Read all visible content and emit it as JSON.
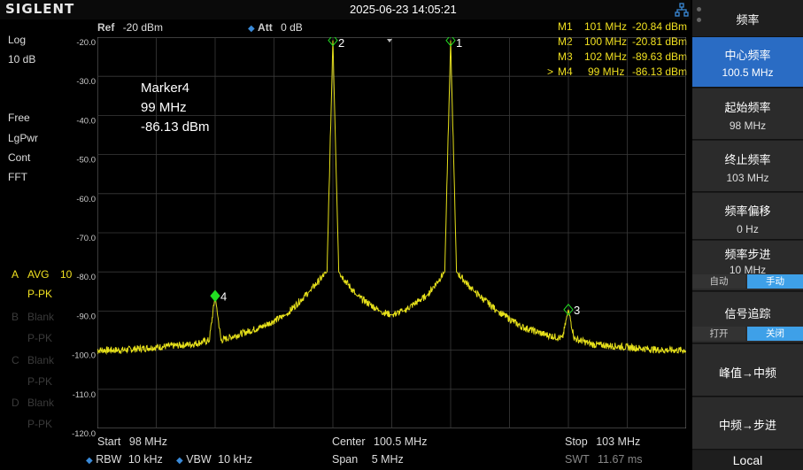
{
  "header": {
    "brand": "SIGLENT",
    "datetime": "2025-06-23 14:05:21"
  },
  "trace_settings": {
    "scale_type": "Log",
    "scale_div": "10 dB",
    "sweep_mode": "Free",
    "detector_type": "LgPwr",
    "cont": "Cont",
    "mode": "FFT"
  },
  "traces": [
    {
      "id": "A",
      "mode": "AVG",
      "count": "10",
      "detector": "P-PK",
      "active": true
    },
    {
      "id": "B",
      "mode": "Blank",
      "detector": "P-PK",
      "active": false
    },
    {
      "id": "C",
      "mode": "Blank",
      "detector": "P-PK",
      "active": false
    },
    {
      "id": "D",
      "mode": "Blank",
      "detector": "P-PK",
      "active": false
    }
  ],
  "top_info": {
    "ref_label": "Ref",
    "ref_value": "-20 dBm",
    "att_label": "Att",
    "att_value": "0 dB"
  },
  "markers": [
    {
      "name": "M1",
      "freq": "101 MHz",
      "level": "-20.84 dBm",
      "selected": false
    },
    {
      "name": "M2",
      "freq": "100 MHz",
      "level": "-20.81 dBm",
      "selected": false
    },
    {
      "name": "M3",
      "freq": "102 MHz",
      "level": "-89.63 dBm",
      "selected": false
    },
    {
      "name": "M4",
      "freq": "99 MHz",
      "level": "-86.13 dBm",
      "selected": true
    }
  ],
  "marker_select_glyph": ">",
  "marker_readout": {
    "name": "Marker4",
    "freq": "99 MHz",
    "level": "-86.13 dBm"
  },
  "chart_data": {
    "type": "line",
    "y_ticks": [
      "-20.0",
      "-30.0",
      "-40.0",
      "-50.0",
      "-60.0",
      "-70.0",
      "-80.0",
      "-90.0",
      "-100.0",
      "-110.0",
      "-120.0"
    ],
    "xlim": [
      98,
      103
    ],
    "ylim": [
      -120,
      -20
    ],
    "grid": true,
    "series": [
      {
        "x": [
          98.0,
          98.2,
          98.4,
          98.6,
          98.8,
          98.95,
          99.0,
          99.05,
          99.2,
          99.4,
          99.6,
          99.8,
          99.95,
          100.0,
          100.05,
          100.2,
          100.4,
          100.5,
          100.6,
          100.8,
          100.95,
          101.0,
          101.05,
          101.2,
          101.4,
          101.6,
          101.8,
          101.95,
          102.0,
          102.05,
          102.2,
          102.4,
          102.6,
          102.8,
          103.0
        ],
        "y": [
          -100.0,
          -100.0,
          -99.5,
          -99.0,
          -98.5,
          -97.5,
          -86.13,
          -97.5,
          -96.0,
          -94.0,
          -91.0,
          -85.0,
          -80.0,
          -20.81,
          -80.0,
          -86.0,
          -90.0,
          -91.0,
          -90.0,
          -86.0,
          -80.0,
          -20.84,
          -80.0,
          -85.0,
          -90.0,
          -94.0,
          -96.0,
          -97.0,
          -89.63,
          -97.0,
          -98.5,
          -99.0,
          -99.5,
          -100.0,
          -100.0
        ]
      }
    ],
    "peak_markers": [
      {
        "label": "1",
        "x": 101.0,
        "y": -20.84
      },
      {
        "label": "2",
        "x": 100.0,
        "y": -20.81
      },
      {
        "label": "3",
        "x": 102.0,
        "y": -89.63
      },
      {
        "label": "4",
        "x": 99.0,
        "y": -86.13
      }
    ]
  },
  "footer": {
    "start_label": "Start",
    "start_value": "98 MHz",
    "center_label": "Center",
    "center_value": "100.5 MHz",
    "stop_label": "Stop",
    "stop_value": "103 MHz",
    "rbw_label": "RBW",
    "rbw_value": "10 kHz",
    "vbw_label": "VBW",
    "vbw_value": "10 kHz",
    "span_label": "Span",
    "span_value": "5 MHz",
    "swt_label": "SWT",
    "swt_value": "11.67 ms"
  },
  "softkeys": {
    "menu_title": "频率",
    "center_freq_label": "中心频率",
    "center_freq_value": "100.5 MHz",
    "start_freq_label": "起始频率",
    "start_freq_value": "98 MHz",
    "stop_freq_label": "终止频率",
    "stop_freq_value": "103 MHz",
    "freq_offset_label": "频率偏移",
    "freq_offset_value": "0 Hz",
    "freq_step_label": "频率步进",
    "freq_step_value": "10 MHz",
    "step_auto": "自动",
    "step_manual": "手动",
    "signal_track_label": "信号追踪",
    "track_on": "打开",
    "track_off": "关闭",
    "peak_to_center": "峰值→中频",
    "center_to_step": "中频→步进",
    "local": "Local"
  },
  "colors": {
    "trace": "#e6e01a",
    "marker_active": "#22dd22",
    "marker_inactive": "#2c8c2c",
    "accent": "#2a6cc4",
    "toggle_on": "#3ea0e8"
  }
}
